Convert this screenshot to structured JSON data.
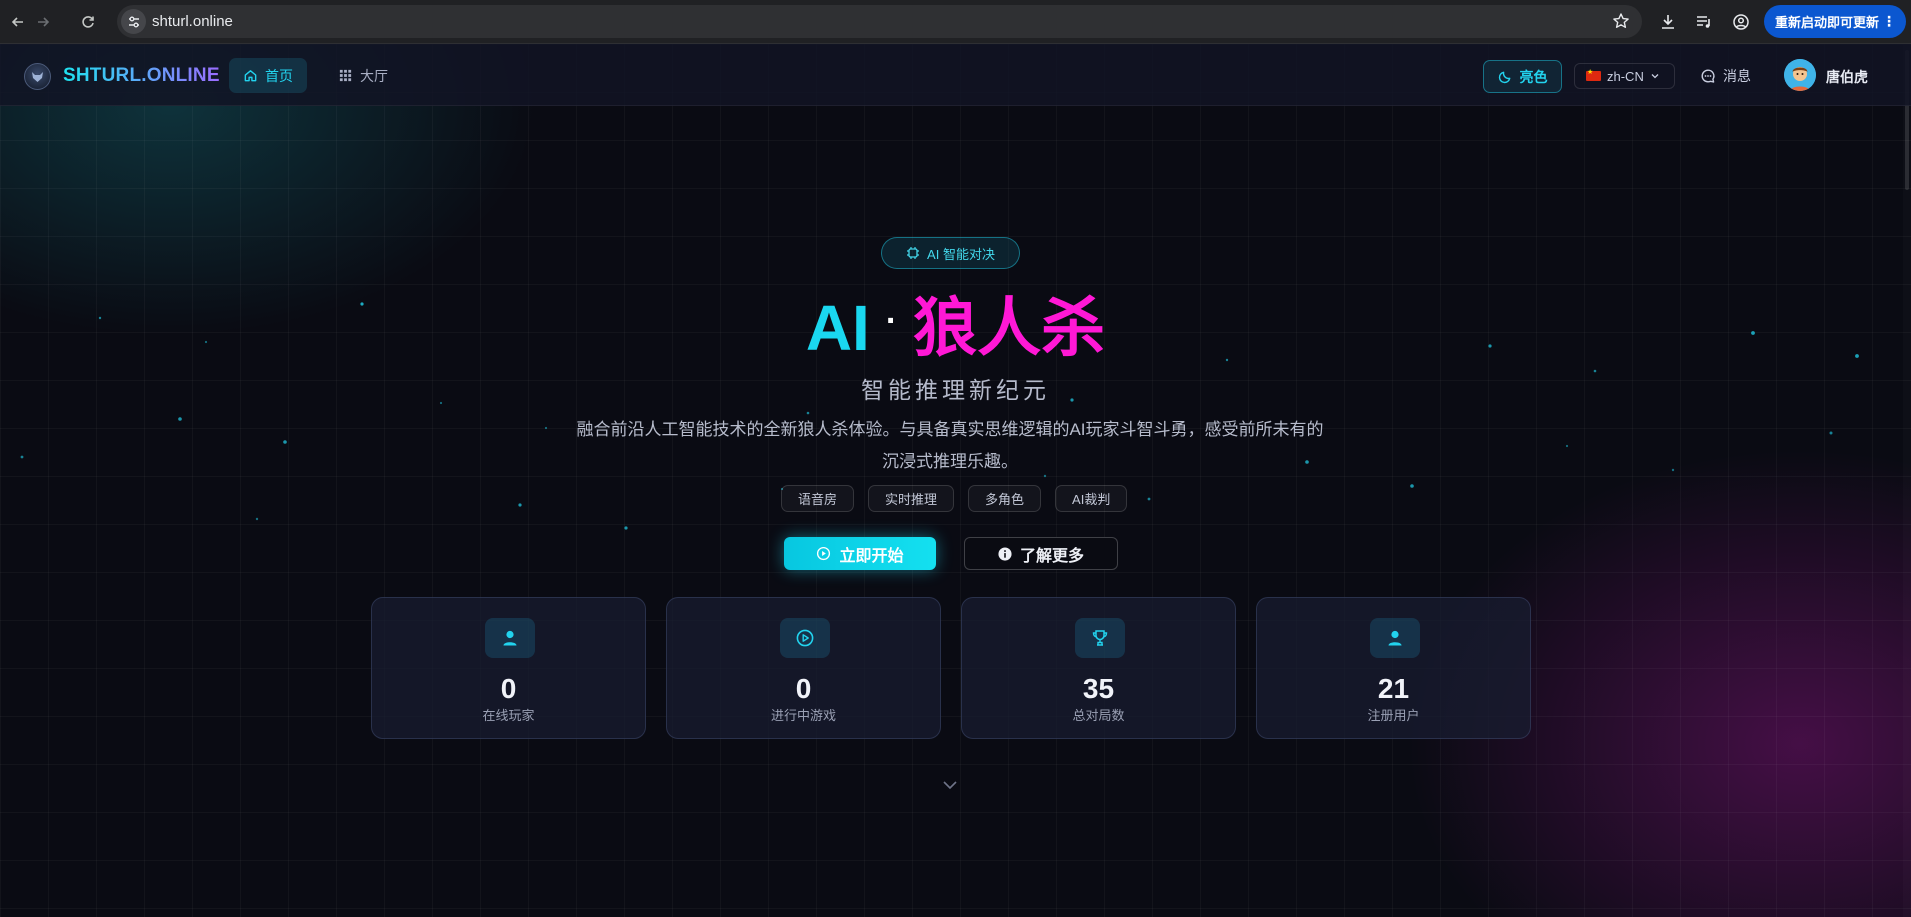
{
  "browser": {
    "url": "shturl.online",
    "update_label": "重新启动即可更新",
    "icons": [
      "back-icon",
      "forward-icon",
      "reload-icon",
      "site-info-icon",
      "star-icon",
      "download-icon",
      "media-queue-icon",
      "profile-icon",
      "more-icon"
    ]
  },
  "header": {
    "brand": "SHTURL.ONLINE",
    "nav": [
      {
        "label": "首页",
        "icon": "home-icon",
        "active": true
      },
      {
        "label": "大厅",
        "icon": "grid-icon",
        "active": false
      }
    ],
    "theme_label": "亮色",
    "language_label": "zh-CN",
    "messages_label": "消息",
    "username": "唐伯虎"
  },
  "hero": {
    "badge": "AI 智能对决",
    "title_ai": "AI",
    "title_dot": "·",
    "title_game": "狼人杀",
    "subtitle": "智能推理新纪元",
    "description_line1": "融合前沿人工智能技术的全新狼人杀体验。与具备真实思维逻辑的AI玩家斗智斗勇，感受前所未有的",
    "description_line2": "沉浸式推理乐趣。",
    "tags": [
      "语音房",
      "实时推理",
      "多角色",
      "AI裁判"
    ],
    "primary_button": "立即开始",
    "secondary_button": "了解更多"
  },
  "stats": [
    {
      "value": "0",
      "label": "在线玩家",
      "icon": "user-icon"
    },
    {
      "value": "0",
      "label": "进行中游戏",
      "icon": "play-icon"
    },
    {
      "value": "35",
      "label": "总对局数",
      "icon": "trophy-icon"
    },
    {
      "value": "21",
      "label": "注册用户",
      "icon": "user-icon"
    }
  ],
  "colors": {
    "accent_cyan": "#1ad8f0",
    "accent_magenta": "#ff18d5",
    "background": "#0a0b13",
    "browser_update_blue": "#0b57d0"
  }
}
